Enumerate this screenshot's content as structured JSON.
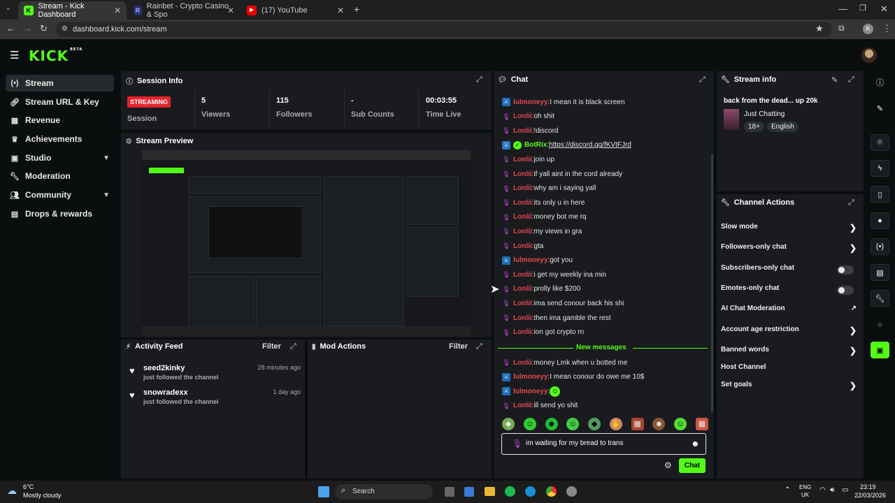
{
  "browser": {
    "tabs": [
      {
        "title": "Stream - Kick Dashboard",
        "active": true
      },
      {
        "title": "Rainbet - Crypto Casino & Spo",
        "active": false
      },
      {
        "title": "(17) YouTube",
        "active": false
      }
    ],
    "url": "dashboard.kick.com/stream",
    "profile_initial": "K"
  },
  "brand": {
    "logo": "KICK",
    "logo_sup": "BETA",
    "accent": "#53fc18"
  },
  "sidebar": {
    "items": [
      {
        "label": "Stream",
        "icon": "stream-icon"
      },
      {
        "label": "Stream URL & Key",
        "icon": "link-icon"
      },
      {
        "label": "Revenue",
        "icon": "revenue-icon"
      },
      {
        "label": "Achievements",
        "icon": "trophy-icon"
      },
      {
        "label": "Studio",
        "icon": "studio-icon"
      },
      {
        "label": "Moderation",
        "icon": "wrench-icon"
      },
      {
        "label": "Community",
        "icon": "community-icon"
      },
      {
        "label": "Drops & rewards",
        "icon": "drops-icon"
      }
    ]
  },
  "session": {
    "title": "Session Info",
    "badge": "STREAMING",
    "session_label": "Session",
    "stats": [
      {
        "value": "5",
        "label": "Viewers"
      },
      {
        "value": "115",
        "label": "Followers"
      },
      {
        "value": "-",
        "label": "Sub Counts"
      },
      {
        "value": "00:03:55",
        "label": "Time Live"
      }
    ]
  },
  "preview": {
    "title": "Stream Preview"
  },
  "activity": {
    "title": "Activity Feed",
    "filter": "Filter",
    "items": [
      {
        "name": "seed2kinky",
        "sub": "just followed the channel",
        "time": "28 minutes ago"
      },
      {
        "name": "snowradexx",
        "sub": "just followed the channel",
        "time": "1 day ago"
      }
    ]
  },
  "mod_actions": {
    "title": "Mod Actions",
    "filter": "Filter"
  },
  "chat": {
    "title": "Chat",
    "messages": [
      {
        "user": "lulmoneyy",
        "color": "#e5484d",
        "badge": "sword",
        "text": "I mean it is black screen"
      },
      {
        "user": "Lonlii",
        "color": "#e5484d",
        "badge": "mic",
        "text": "oh shit"
      },
      {
        "user": "Lonlii",
        "color": "#e5484d",
        "badge": "mic",
        "text": "!discord"
      },
      {
        "user": "BotRix",
        "color": "#53fc18",
        "badge": "bot",
        "text": "https://discord.gg/fKVtFJrd"
      },
      {
        "user": "Lonlii",
        "color": "#e5484d",
        "badge": "mic",
        "text": "join up"
      },
      {
        "user": "Lonlii",
        "color": "#e5484d",
        "badge": "mic",
        "text": "if yall aint in the cord already"
      },
      {
        "user": "Lonlii",
        "color": "#e5484d",
        "badge": "mic",
        "text": "why am i saying yall"
      },
      {
        "user": "Lonlii",
        "color": "#e5484d",
        "badge": "mic",
        "text": "its only u in here"
      },
      {
        "user": "Lonlii",
        "color": "#e5484d",
        "badge": "mic",
        "text": "money bot me rq"
      },
      {
        "user": "Lonlii",
        "color": "#e5484d",
        "badge": "mic",
        "text": "my views in gra"
      },
      {
        "user": "Lonlii",
        "color": "#e5484d",
        "badge": "mic",
        "text": "gta"
      },
      {
        "user": "lulmoneyy",
        "color": "#e5484d",
        "badge": "sword",
        "text": "got you"
      },
      {
        "user": "Lonlii",
        "color": "#e5484d",
        "badge": "mic",
        "text": "i get my weekly ina min"
      },
      {
        "user": "Lonlii",
        "color": "#e5484d",
        "badge": "mic",
        "text": "prolly like $200"
      },
      {
        "user": "Lonlii",
        "color": "#e5484d",
        "badge": "mic",
        "text": "ima send conour back his shi"
      },
      {
        "user": "Lonlii",
        "color": "#e5484d",
        "badge": "mic",
        "text": "then ima gamble the rest"
      },
      {
        "user": "Lonlii",
        "color": "#e5484d",
        "badge": "mic",
        "text": "ion got crypto rn"
      }
    ],
    "new_messages_label": "New messages",
    "new_messages": [
      {
        "user": "Lonlii",
        "color": "#e5484d",
        "badge": "mic",
        "text": "money Lmk when u botted me"
      },
      {
        "user": "lulmoneyy",
        "color": "#e5484d",
        "badge": "sword",
        "text": "I mean conour do owe me 10$"
      },
      {
        "user": "lulmoneyy",
        "color": "#e5484d",
        "badge": "sword",
        "text": ""
      },
      {
        "user": "Lonlii",
        "color": "#e5484d",
        "badge": "mic",
        "text": "ill send yo shit"
      }
    ],
    "input_value": "im waiting for my bread to trans",
    "send_label": "Chat"
  },
  "stream_info": {
    "title": "Stream info",
    "stream_title": "back from the dead... up 20k",
    "category": "Just Chatting",
    "tags": [
      "18+",
      "English"
    ]
  },
  "channel_actions": {
    "title": "Channel Actions",
    "items": [
      {
        "label": "Slow mode",
        "control": "chevron"
      },
      {
        "label": "Followers-only chat",
        "control": "chevron"
      },
      {
        "label": "Subscribers-only chat",
        "control": "toggle"
      },
      {
        "label": "Emotes-only chat",
        "control": "toggle"
      },
      {
        "label": "AI Chat Moderation",
        "control": "external"
      },
      {
        "label": "Account age restriction",
        "control": "chevron"
      },
      {
        "label": "Banned words",
        "control": "chevron"
      },
      {
        "label": "Host Channel",
        "control": "none"
      },
      {
        "label": "Set goals",
        "control": "chevron"
      }
    ]
  },
  "taskbar": {
    "weather_temp": "6°C",
    "weather_desc": "Mostly cloudy",
    "search_label": "Search",
    "lang_1": "ENG",
    "lang_2": "UK",
    "time": "23:19",
    "date": "22/03/2026"
  }
}
